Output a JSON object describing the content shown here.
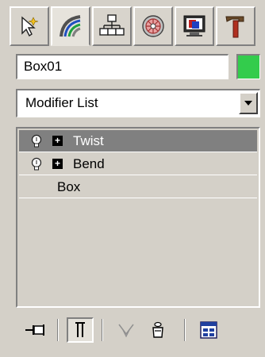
{
  "command_panel": {
    "tabs": [
      {
        "name": "create",
        "icon": "cursor-sparkle-icon",
        "active": false
      },
      {
        "name": "modify",
        "icon": "modify-rainbow-icon",
        "active": true
      },
      {
        "name": "hierarchy",
        "icon": "hierarchy-icon",
        "active": false
      },
      {
        "name": "motion",
        "icon": "motion-wheel-icon",
        "active": false
      },
      {
        "name": "display",
        "icon": "display-monitor-icon",
        "active": false
      },
      {
        "name": "utilities",
        "icon": "hammer-icon",
        "active": false
      }
    ],
    "object_name": "Box01",
    "object_color": "#33cc4c",
    "modifier_list_label": "Modifier List",
    "stack": [
      {
        "name": "Twist",
        "selected": true,
        "has_bulb": true,
        "has_plus": true
      },
      {
        "name": "Bend",
        "selected": false,
        "has_bulb": true,
        "has_plus": true
      },
      {
        "name": "Box",
        "selected": false,
        "has_bulb": false,
        "has_plus": false
      }
    ],
    "toolbar": [
      {
        "name": "pin-stack",
        "icon": "pin-icon"
      },
      {
        "name": "show-end-result",
        "icon": "show-end-result-icon",
        "pressed": true
      },
      {
        "name": "make-unique",
        "icon": "make-unique-icon"
      },
      {
        "name": "remove-modifier",
        "icon": "remove-modifier-icon"
      },
      {
        "name": "configure-modifier-sets",
        "icon": "configure-sets-icon"
      }
    ]
  }
}
